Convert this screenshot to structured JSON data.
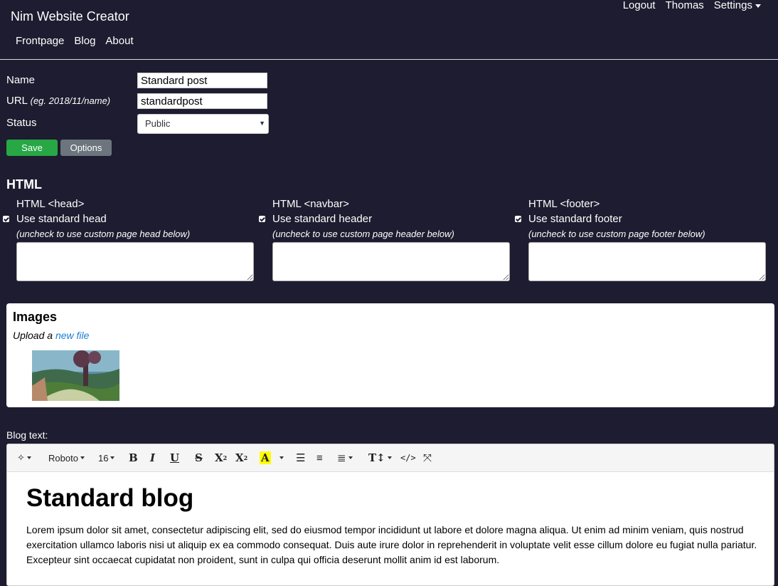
{
  "header": {
    "brand": "Nim Website Creator",
    "nav": [
      "Frontpage",
      "Blog",
      "About"
    ],
    "user_nav": {
      "logout": "Logout",
      "user": "Thomas",
      "settings": "Settings"
    }
  },
  "form": {
    "name_label": "Name",
    "name_value": "Standard post",
    "url_label": "URL",
    "url_hint": "(eg. 2018/11/name)",
    "url_value": "standardpost",
    "status_label": "Status",
    "status_value": "Public",
    "save_label": "Save",
    "options_label": "Options"
  },
  "html_section": {
    "title": "HTML",
    "columns": [
      {
        "title": "HTML <head>",
        "checkbox_label": "Use standard head",
        "checked": true,
        "hint": "(uncheck to use custom page head below)"
      },
      {
        "title": "HTML <navbar>",
        "checkbox_label": "Use standard header",
        "checked": true,
        "hint": "(uncheck to use custom page header below)"
      },
      {
        "title": "HTML <footer>",
        "checkbox_label": "Use standard footer",
        "checked": true,
        "hint": "(uncheck to use custom page footer below)"
      }
    ]
  },
  "images": {
    "title": "Images",
    "upload_prefix": "Upload a",
    "upload_link": "new file"
  },
  "editor": {
    "label": "Blog text:",
    "toolbar": {
      "font": "Roboto",
      "size": "16",
      "icons": [
        "magic-icon",
        "bold-icon",
        "italic-icon",
        "underline-icon",
        "strikethrough-icon",
        "superscript-icon",
        "subscript-icon",
        "font-color-icon",
        "unordered-list-icon",
        "ordered-list-icon",
        "align-icon",
        "text-height-icon",
        "code-view-icon",
        "fullscreen-icon"
      ]
    },
    "heading": "Standard blog",
    "paragraph": "Lorem ipsum dolor sit amet, consectetur adipiscing elit, sed do eiusmod tempor incididunt ut labore et dolore magna aliqua. Ut enim ad minim veniam, quis nostrud exercitation ullamco laboris nisi ut aliquip ex ea commodo consequat. Duis aute irure dolor in reprehenderit in voluptate velit esse cillum dolore eu fugiat nulla pariatur. Excepteur sint occaecat cupidatat non proident, sunt in culpa qui officia deserunt mollit anim id est laborum."
  },
  "colors": {
    "background": "#1d1c30",
    "save": "#28a745",
    "options": "#6c757d",
    "link": "#1a7fd4",
    "highlight": "#ffff00"
  }
}
